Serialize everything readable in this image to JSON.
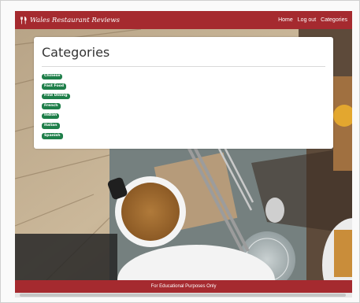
{
  "navbar": {
    "brand": "Wales Restaurant Reviews",
    "brand_icon": "fork-knife-icon",
    "links": [
      "Home",
      "Log out",
      "Categories"
    ]
  },
  "card": {
    "title": "Categories",
    "categories": [
      "Chinese",
      "Fast Food",
      "Fine Dining",
      "French",
      "Indian",
      "Italian",
      "Spanish"
    ]
  },
  "footer": {
    "text": "For Educational Purposes Only"
  },
  "colors": {
    "brand": "#a52a2f",
    "badge": "#1f7f4a"
  }
}
